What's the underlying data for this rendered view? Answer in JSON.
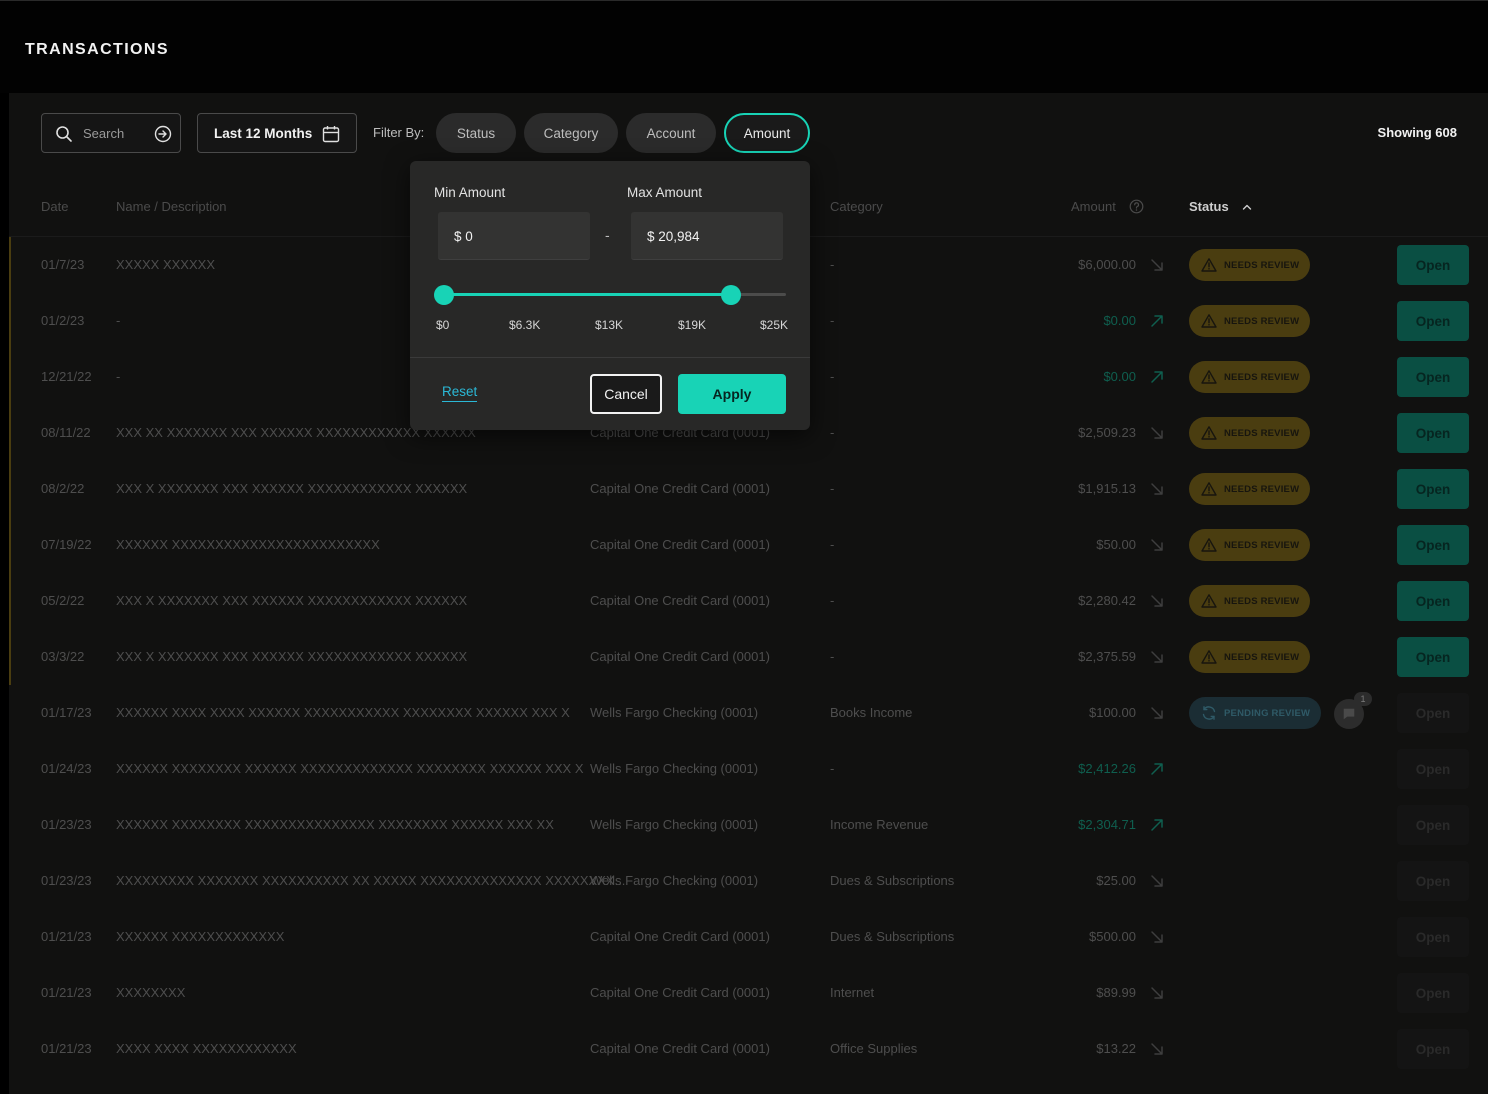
{
  "header": {
    "title": "TRANSACTIONS"
  },
  "toolbar": {
    "search_placeholder": "Search",
    "date_range": "Last 12 Months",
    "filter_by_label": "Filter By:",
    "filters": [
      "Status",
      "Category",
      "Account",
      "Amount"
    ],
    "active_filter": "Amount",
    "showing": "Showing 608"
  },
  "table": {
    "columns": {
      "date": "Date",
      "name": "Name / Description",
      "category": "Category",
      "amount": "Amount",
      "status": "Status"
    },
    "rows": [
      {
        "date": "01/7/23",
        "name": "XXXXX XXXXXX",
        "account": "",
        "category": "-",
        "amount": "$6,000.00",
        "direction": "out",
        "status": "NEEDS REVIEW",
        "action": "Open"
      },
      {
        "date": "01/2/23",
        "name": "-",
        "account": "",
        "category": "-",
        "amount": "$0.00",
        "direction": "in",
        "status": "NEEDS REVIEW",
        "action": "Open"
      },
      {
        "date": "12/21/22",
        "name": "-",
        "account": "",
        "category": "-",
        "amount": "$0.00",
        "direction": "in",
        "status": "NEEDS REVIEW",
        "action": "Open"
      },
      {
        "date": "08/11/22",
        "name": "XXX XX XXXXXXX XXX XXXXXX XXXXXXXXXXXX XXXXXX",
        "account": "Capital One Credit Card (0001)",
        "category": "-",
        "amount": "$2,509.23",
        "direction": "out",
        "status": "NEEDS REVIEW",
        "action": "Open"
      },
      {
        "date": "08/2/22",
        "name": "XXX X XXXXXXX XXX XXXXXX XXXXXXXXXXXX XXXXXX",
        "account": "Capital One Credit Card (0001)",
        "category": "-",
        "amount": "$1,915.13",
        "direction": "out",
        "status": "NEEDS REVIEW",
        "action": "Open"
      },
      {
        "date": "07/19/22",
        "name": "XXXXXX XXXXXXXXXXXXXXXXXXXXXXXX",
        "account": "Capital One Credit Card (0001)",
        "category": "-",
        "amount": "$50.00",
        "direction": "out",
        "status": "NEEDS REVIEW",
        "action": "Open"
      },
      {
        "date": "05/2/22",
        "name": "XXX X XXXXXXX XXX XXXXXX XXXXXXXXXXXX XXXXXX",
        "account": "Capital One Credit Card (0001)",
        "category": "-",
        "amount": "$2,280.42",
        "direction": "out",
        "status": "NEEDS REVIEW",
        "action": "Open"
      },
      {
        "date": "03/3/22",
        "name": "XXX X XXXXXXX XXX XXXXXX XXXXXXXXXXXX XXXXXX",
        "account": "Capital One Credit Card (0001)",
        "category": "-",
        "amount": "$2,375.59",
        "direction": "out",
        "status": "NEEDS REVIEW",
        "action": "Open"
      },
      {
        "date": "01/17/23",
        "name": "XXXXXX XXXX XXXX XXXXXX XXXXXXXXXXX XXXXXXXX XXXXXX XXX X",
        "account": "Wells Fargo Checking (0001)",
        "category": "Books Income",
        "amount": "$100.00",
        "direction": "out",
        "status": "PENDING REVIEW",
        "comments": "1",
        "action": "Open"
      },
      {
        "date": "01/24/23",
        "name": "XXXXXX XXXXXXXX XXXXXX XXXXXXXXXXXXX XXXXXXXX XXXXXX XXX X",
        "account": "Wells Fargo Checking (0001)",
        "category": "-",
        "amount": "$2,412.26",
        "direction": "in",
        "status": "",
        "action": "Open"
      },
      {
        "date": "01/23/23",
        "name": "XXXXXX XXXXXXXX XXXXXXXXXXXXXXX XXXXXXXX XXXXXX XXX XX",
        "account": "Wells Fargo Checking (0001)",
        "category": "Income Revenue",
        "amount": "$2,304.71",
        "direction": "in",
        "status": "",
        "action": "Open"
      },
      {
        "date": "01/23/23",
        "name": "XXXXXXXXX XXXXXXX XXXXXXXXXX XX XXXXX XXXXXXXXXXXXXX XXXXXXXX...",
        "account": "Wells Fargo Checking (0001)",
        "category": "Dues & Subscriptions",
        "amount": "$25.00",
        "direction": "out",
        "status": "",
        "action": "Open"
      },
      {
        "date": "01/21/23",
        "name": "XXXXXX XXXXXXXXXXXXX",
        "account": "Capital One Credit Card (0001)",
        "category": "Dues & Subscriptions",
        "amount": "$500.00",
        "direction": "out",
        "status": "",
        "action": "Open"
      },
      {
        "date": "01/21/23",
        "name": "XXXXXXXX",
        "account": "Capital One Credit Card (0001)",
        "category": "Internet",
        "amount": "$89.99",
        "direction": "out",
        "status": "",
        "action": "Open"
      },
      {
        "date": "01/21/23",
        "name": "XXXX XXXX XXXXXXXXXXXX",
        "account": "Capital One Credit Card (0001)",
        "category": "Office Supplies",
        "amount": "$13.22",
        "direction": "out",
        "status": "",
        "action": "Open"
      }
    ]
  },
  "amount_filter": {
    "min_label": "Min Amount",
    "max_label": "Max Amount",
    "min_value": "$ 0",
    "max_value": "$ 20,984",
    "separator": "-",
    "range_min": 0,
    "range_max": 25000,
    "selected_min": 0,
    "selected_max": 20984,
    "ticks": [
      "$0",
      "$6.3K",
      "$13K",
      "$19K",
      "$25K"
    ],
    "reset_label": "Reset",
    "cancel_label": "Cancel",
    "apply_label": "Apply"
  },
  "colors": {
    "accent": "#18d3b6",
    "needs_review": "#4a3d10",
    "pending_review": "#1b2d34",
    "link": "#2bb8d6"
  }
}
